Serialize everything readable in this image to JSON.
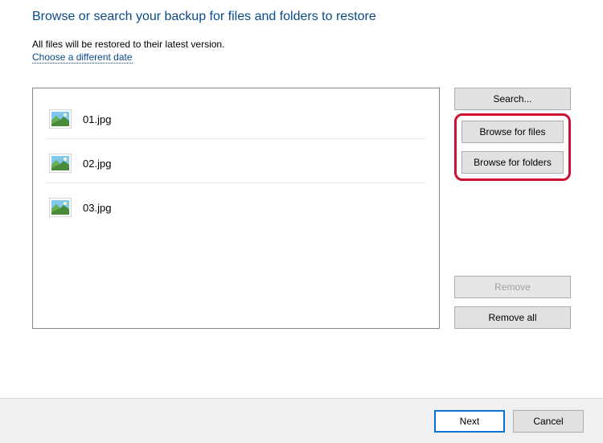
{
  "title": "Browse or search your backup for files and folders to restore",
  "subtitle": "All files will be restored to their latest version.",
  "link_text": "Choose a different date",
  "files": [
    {
      "name": "01.jpg"
    },
    {
      "name": "02.jpg"
    },
    {
      "name": "03.jpg"
    }
  ],
  "buttons": {
    "search": "Search...",
    "browse_files": "Browse for files",
    "browse_folders": "Browse for folders",
    "remove": "Remove",
    "remove_all": "Remove all",
    "next": "Next",
    "cancel": "Cancel"
  }
}
